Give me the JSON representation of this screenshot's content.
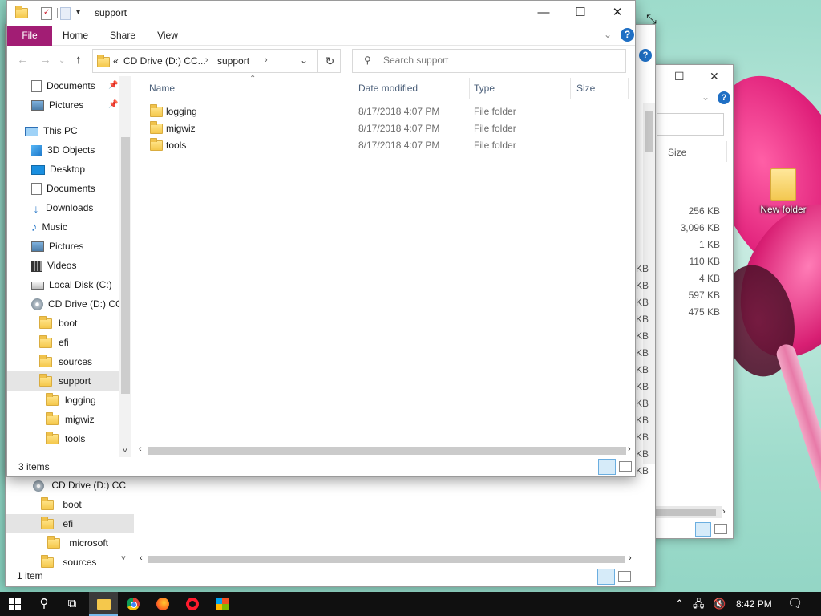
{
  "desktop": {
    "icon_label": "New folder"
  },
  "back_window_2": {
    "help": "?",
    "column_size": "Size",
    "sizes": [
      "256 KB",
      "3,096 KB",
      "1 KB",
      "110 KB",
      "4 KB",
      "597 KB",
      "475 KB"
    ]
  },
  "back_window_1": {
    "help": "?",
    "kb_fragments": [
      "KB",
      "KB",
      "KB",
      "KB",
      "KB",
      "KB",
      "KB",
      "KB",
      "KB",
      "KB",
      "KB",
      "KB",
      "KB"
    ],
    "nav": [
      {
        "label": "CD Drive (D:) CC",
        "icon": "cd-icon"
      },
      {
        "label": "boot",
        "icon": "folder-icon"
      },
      {
        "label": "efi",
        "icon": "folder-icon",
        "selected": true
      },
      {
        "label": "microsoft",
        "icon": "folder-icon"
      },
      {
        "label": "sources",
        "icon": "folder-icon"
      }
    ],
    "status": "1 item"
  },
  "front_window": {
    "title": "support",
    "caption": {
      "minimize": "—",
      "maximize": "☐",
      "close": "✕"
    },
    "ribbon_tabs": [
      "File",
      "Home",
      "Share",
      "View"
    ],
    "help": "?",
    "address": {
      "overflow": "«",
      "crumbs": [
        "CD Drive (D:) CC...",
        "support"
      ]
    },
    "search_placeholder": "Search support",
    "nav_items": [
      {
        "label": "Documents",
        "icon": "documents-icon",
        "pinned": true
      },
      {
        "label": "Pictures",
        "icon": "pictures-icon",
        "pinned": true
      },
      {
        "label": "This PC",
        "icon": "computer-icon"
      },
      {
        "label": "3D Objects",
        "icon": "3d-objects-icon"
      },
      {
        "label": "Desktop",
        "icon": "desktop-icon"
      },
      {
        "label": "Documents",
        "icon": "documents-icon"
      },
      {
        "label": "Downloads",
        "icon": "downloads-icon"
      },
      {
        "label": "Music",
        "icon": "music-icon"
      },
      {
        "label": "Pictures",
        "icon": "pictures-icon"
      },
      {
        "label": "Videos",
        "icon": "videos-icon"
      },
      {
        "label": "Local Disk (C:)",
        "icon": "disk-icon"
      },
      {
        "label": "CD Drive (D:) CC",
        "icon": "cd-icon"
      },
      {
        "label": "boot",
        "icon": "folder-icon"
      },
      {
        "label": "efi",
        "icon": "folder-icon"
      },
      {
        "label": "sources",
        "icon": "folder-icon"
      },
      {
        "label": "support",
        "icon": "folder-icon",
        "selected": true
      },
      {
        "label": "logging",
        "icon": "folder-icon"
      },
      {
        "label": "migwiz",
        "icon": "folder-icon"
      },
      {
        "label": "tools",
        "icon": "folder-icon"
      }
    ],
    "columns": {
      "name": "Name",
      "date": "Date modified",
      "type": "Type",
      "size": "Size"
    },
    "files": [
      {
        "name": "logging",
        "date": "8/17/2018 4:07 PM",
        "type": "File folder"
      },
      {
        "name": "migwiz",
        "date": "8/17/2018 4:07 PM",
        "type": "File folder"
      },
      {
        "name": "tools",
        "date": "8/17/2018 4:07 PM",
        "type": "File folder"
      }
    ],
    "status": "3 items"
  },
  "taskbar": {
    "apps": [
      "start-icon",
      "search-icon",
      "task-view-icon",
      "file-explorer-icon",
      "chrome-icon",
      "firefox-icon",
      "opera-icon",
      "tool-icon"
    ],
    "clock": "8:42 PM"
  }
}
